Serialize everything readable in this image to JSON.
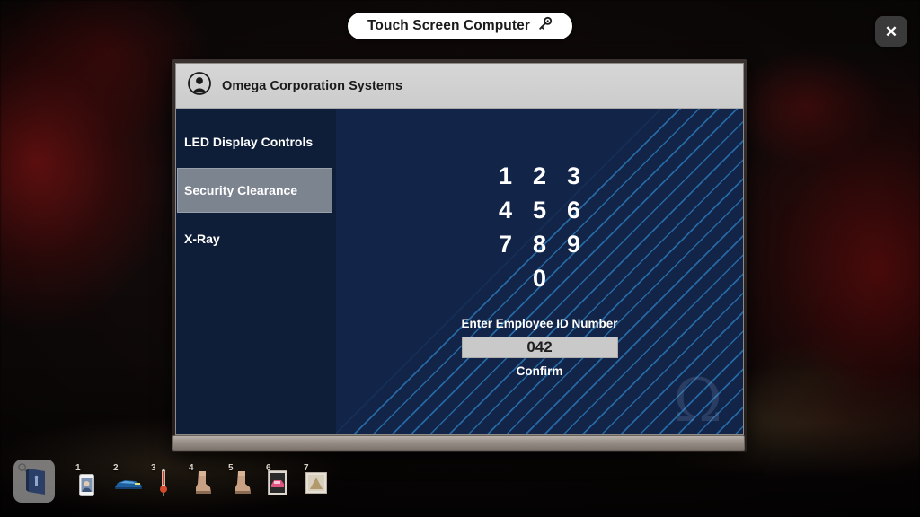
{
  "window": {
    "title": "Touch Screen Computer",
    "title_icon": "key-icon",
    "close_label": "✕"
  },
  "app": {
    "header": {
      "icon": "user-avatar-icon",
      "title": "Omega Corporation Systems"
    },
    "sidebar": {
      "items": [
        {
          "label": "LED Display Controls",
          "active": false
        },
        {
          "label": "Security Clearance",
          "active": true
        },
        {
          "label": "X-Ray",
          "active": false
        }
      ]
    },
    "keypad": {
      "rows": [
        [
          "1",
          "2",
          "3"
        ],
        [
          "4",
          "5",
          "6"
        ],
        [
          "7",
          "8",
          "9"
        ],
        [
          "",
          "0",
          ""
        ]
      ]
    },
    "entry": {
      "label": "Enter Employee ID Number",
      "value": "042",
      "placeholder": "",
      "confirm_label": "Confirm"
    },
    "watermark": "Ω"
  },
  "hotbar": {
    "equipped": {
      "name": "blue-book-item",
      "badge": "search-icon"
    },
    "slots": [
      {
        "number": "1",
        "name": "phone-item"
      },
      {
        "number": "2",
        "name": "blue-car-item"
      },
      {
        "number": "3",
        "name": "thermometer-item"
      },
      {
        "number": "4",
        "name": "boot-item"
      },
      {
        "number": "5",
        "name": "boot-item"
      },
      {
        "number": "6",
        "name": "car-card-item"
      },
      {
        "number": "7",
        "name": "framed-picture-item"
      }
    ]
  },
  "colors": {
    "panel_navy": "#122548",
    "sidebar_navy": "#0f1e38",
    "accent_blue": "#2d7fc4",
    "active_gray": "#7c8490",
    "input_gray": "#c9c9c9"
  }
}
